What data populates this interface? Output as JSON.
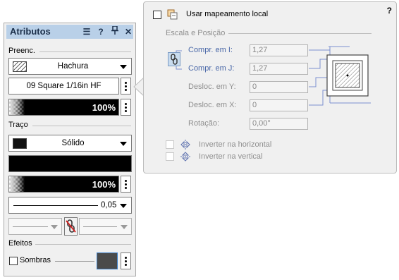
{
  "palette": {
    "title": "Atributos",
    "fill": {
      "section_label": "Preenc.",
      "style_value": "Hachura",
      "hatch_name": "09 Square 1/16in HF",
      "opacity": "100%"
    },
    "stroke": {
      "section_label": "Traço",
      "style_value": "Sólido",
      "opacity": "100%",
      "thickness": "0,05"
    },
    "effects": {
      "section_label": "Efeitos",
      "shadows_label": "Sombras"
    },
    "colors": {
      "title_bar": "#b9d0e8",
      "shadow_swatch": "#4a4a4a"
    }
  },
  "popover": {
    "help": "?",
    "use_local_mapping": {
      "label": "Usar mapeamento local",
      "checked": false
    },
    "scale_section": "Escala e Posição",
    "fields": [
      {
        "label": "Compr. em I:",
        "value": "1,27",
        "color": "blue"
      },
      {
        "label": "Compr. em J:",
        "value": "1,27",
        "color": "blue"
      },
      {
        "label": "Desloc. em Y:",
        "value": "0",
        "color": "gray"
      },
      {
        "label": "Desloc. em X:",
        "value": "0",
        "color": "gray"
      },
      {
        "label": "Rotação:",
        "value": "0,00°",
        "color": "gray"
      }
    ],
    "flip_horizontal": {
      "label": "Inverter na horizontal",
      "checked": false
    },
    "flip_vertical": {
      "label": "Inverter na vertical",
      "checked": false
    }
  }
}
